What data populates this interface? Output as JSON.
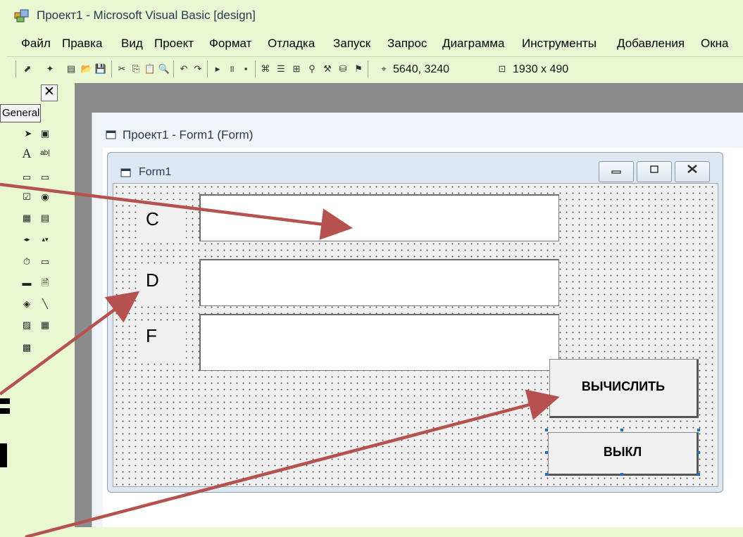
{
  "window": {
    "title": "Проект1 - Microsoft Visual Basic [design]"
  },
  "menu": [
    {
      "label": "Файл"
    },
    {
      "label": "Правка"
    },
    {
      "label": "Вид"
    },
    {
      "label": "Проект"
    },
    {
      "label": "Формат"
    },
    {
      "label": "Отладка"
    },
    {
      "label": "Запуск"
    },
    {
      "label": "Запрос"
    },
    {
      "label": "Диаграмма"
    },
    {
      "label": "Инструменты"
    },
    {
      "label": "Добавления"
    },
    {
      "label": "Окна"
    }
  ],
  "toolbar": {
    "position_readout": "5640, 3240",
    "size_readout": "1930 x 490"
  },
  "toolbox": {
    "close_glyph": "✕",
    "tab_label": "General"
  },
  "designer": {
    "window_title": "Проект1 - Form1 (Form)",
    "form_caption": "Form1",
    "labels": {
      "c": "C",
      "d": "D",
      "f": "F"
    },
    "buttons": {
      "calculate": "ВЫЧИСЛИТЬ",
      "off": "ВЫКЛ"
    }
  },
  "colors": {
    "slide_background": "#e9f7d2",
    "arrow": "#b5524f",
    "selection_handle": "#1a6bd6"
  }
}
